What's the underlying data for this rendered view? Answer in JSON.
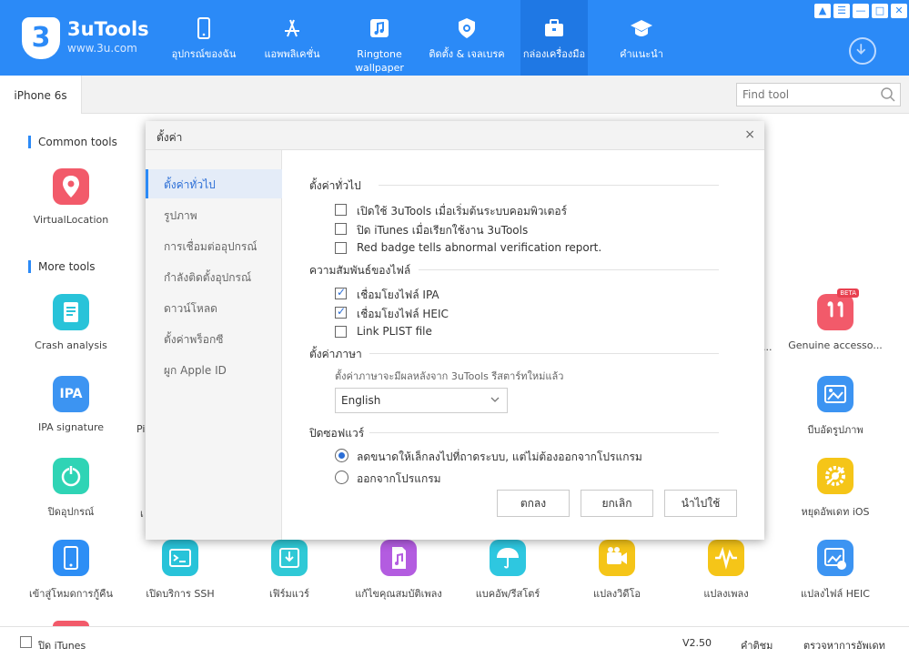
{
  "app": {
    "logo_glyph": "3",
    "name": "3uTools",
    "url": "www.3u.com",
    "accent": "#2b8af7"
  },
  "nav": [
    {
      "label": "อุปกรณ์ของฉัน",
      "icon": "phone-icon"
    },
    {
      "label": "แอพพลิเคชั่น",
      "icon": "app-store-icon"
    },
    {
      "label": "Ringtone wallpaper",
      "icon": "music-note-icon"
    },
    {
      "label": "ติดตั้ง & เจลเบรค",
      "icon": "shield-icon"
    },
    {
      "label": "กล่องเครื่องมือ",
      "icon": "toolbox-icon"
    },
    {
      "label": "คำแนะนำ",
      "icon": "graduation-cap-icon"
    }
  ],
  "window_controls": [
    "shirt-icon",
    "list-icon",
    "minimize-icon",
    "maximize-icon",
    "close-icon"
  ],
  "tabbar": {
    "device": "iPhone 6s",
    "search_placeholder": "Find tool"
  },
  "sections": {
    "common": "Common tools",
    "more": "More tools"
  },
  "tools": {
    "virtual_location": "VirtualLocation",
    "crash_analysis": "Crash analysis",
    "ipa_signature": "IPA signature",
    "ipa_icon_text": "IPA",
    "power_off": "ปิดอุปกรณ์",
    "recovery": "เข้าสู่โหมดการกู้คืน",
    "ssh": "เปิดบริการ SSH",
    "firmware": "เฟิร์มแวร์",
    "music_props": "แก้ไขคุณสมบัติเพลง",
    "backup_restore": "แบคอัพ/รีสโตร์",
    "convert_video": "แปลงวิดีโอ",
    "convert_audio": "แปลงเพลง",
    "convert_heic": "แปลงไฟล์ HEIC",
    "genuine": "Genuine accesso...",
    "genuine_badge": "BETA",
    "compress_photo": "บีบอัดรูปภาพ",
    "stop_update": "หยุดอัพเดท iOS",
    "partial_left_1": "Pi",
    "partial_left_2": "เ",
    "partial_right": "..."
  },
  "footer": {
    "close_itunes": "ปิด iTunes",
    "version": "V2.50",
    "feedback": "คำติชม",
    "check_update": "ตรวจหาการอัพเดท"
  },
  "dialog": {
    "title": "ตั้งค่า",
    "close_glyph": "×",
    "side_items": [
      "ตั้งค่าทั่วไป",
      "รูปภาพ",
      "การเชื่อมต่ออุปกรณ์",
      "กำลังติดตั้งอุปกรณ์",
      "ดาวน์โหลด",
      "ตั้งค่าพร็อกซี",
      "ผูก Apple ID"
    ],
    "general": {
      "title": "ตั้งค่าทั่วไป",
      "options": [
        {
          "label": "เปิดใช้ 3uTools เมื่อเริ่มต้นระบบคอมพิวเตอร์",
          "checked": false
        },
        {
          "label": "ปิด iTunes เมื่อเรียกใช้งาน 3uTools",
          "checked": false
        },
        {
          "label": "Red badge tells abnormal verification report.",
          "checked": false
        }
      ]
    },
    "association": {
      "title": "ความสัมพันธ์ของไฟล์",
      "options": [
        {
          "label": "เชื่อมโยงไฟล์ IPA",
          "checked": true
        },
        {
          "label": "เชื่อมโยงไฟล์ HEIC",
          "checked": true
        },
        {
          "label": "Link PLIST file",
          "checked": false
        }
      ]
    },
    "language": {
      "title": "ตั้งค่าภาษา",
      "hint": "ตั้งค่าภาษาจะมีผลหลังจาก 3uTools รีสตาร์ทใหม่แล้ว",
      "selected": "English"
    },
    "close_software": {
      "title": "ปิดซอฟแวร์",
      "options": [
        {
          "label": "ลดขนาดให้เล็กลงไปที่ถาดระบบ, แต่ไม่ต้องออกจากโปรแกรม",
          "checked": true
        },
        {
          "label": "ออกจากโปรแกรม",
          "checked": false
        }
      ]
    },
    "buttons": {
      "ok": "ตกลง",
      "cancel": "ยกเลิก",
      "apply": "นำไปใช้"
    }
  }
}
